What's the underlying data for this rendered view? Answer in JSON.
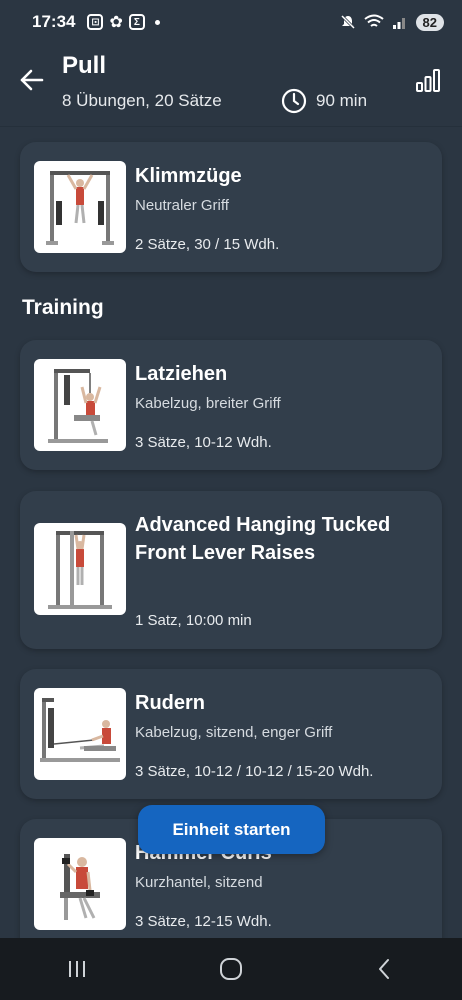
{
  "status_bar": {
    "time": "17:34",
    "battery": "82",
    "icons": [
      "screen-record-icon",
      "openai-icon",
      "sigma-icon",
      "mute-icon",
      "wifi-icon",
      "signal-icon"
    ]
  },
  "header": {
    "title": "Pull",
    "subtitle": "8 Übungen, 20 Sätze",
    "duration": "90 min",
    "icons": [
      "back-arrow-icon",
      "clock-icon",
      "bar-chart-icon"
    ]
  },
  "warmup_card": {
    "title": "Klimmzüge",
    "subtitle": "Neutraler Griff",
    "sets": "2 Sätze, 30 / 15 Wdh."
  },
  "section": {
    "title": "Training"
  },
  "exercises": [
    {
      "title": "Latziehen",
      "subtitle": "Kabelzug, breiter Griff",
      "sets": "3 Sätze, 10-12 Wdh."
    },
    {
      "title": "Advanced Hanging Tucked Front Lever Raises",
      "subtitle": "",
      "sets": "1 Satz, 10:00 min"
    },
    {
      "title": "Rudern",
      "subtitle": "Kabelzug, sitzend, enger Griff",
      "sets": "3 Sätze, 10-12 / 10-12 / 15-20 Wdh."
    },
    {
      "title": "Hammer Curls",
      "subtitle": "Kurzhantel, sitzend",
      "sets": "3 Sätze, 12-15 Wdh."
    }
  ],
  "actions": {
    "start_label": "Einheit starten"
  },
  "colors": {
    "background": "#2b3642",
    "card": "#323e4b",
    "accent": "#1565c0",
    "navbar": "#171b1f"
  }
}
